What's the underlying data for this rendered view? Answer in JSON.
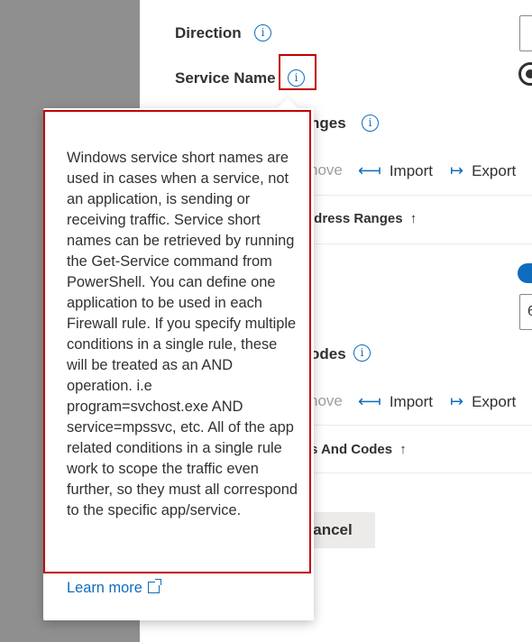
{
  "form": {
    "direction_label": "Direction",
    "service_name_label": "Service Name",
    "address_ranges_label": "nges",
    "address_ranges_header": "ldress Ranges",
    "codes_label": "odes",
    "codes_header": "s And Codes",
    "sort_indicator": "↑",
    "info_glyph": "i"
  },
  "commands": {
    "remove_label": "nove",
    "import_label": "Import",
    "export_label": "Export",
    "import_icon": "⟻",
    "export_icon": "↦"
  },
  "buttons": {
    "cancel_label": "ancel"
  },
  "callout": {
    "text": "Windows service short names are used in cases when a service, not an application, is sending or receiving traffic. Service short names can be retrieved by running the Get-Service command from PowerShell. You can define one application to be used in each Firewall rule. If you specify multiple conditions in a single rule, these will be treated as an AND operation. i.e program=svchost.exe AND service=mpssvc, etc. All of the app related conditions in a single rule work to scope the traffic even further, so they must all correspond to the specific app/service.",
    "learn_more": "Learn more"
  },
  "edge_values": {
    "input2_char": "6"
  },
  "colors": {
    "accent": "#0f6cbd",
    "highlight": "#c00000",
    "scrim": "#8f8f8f"
  }
}
